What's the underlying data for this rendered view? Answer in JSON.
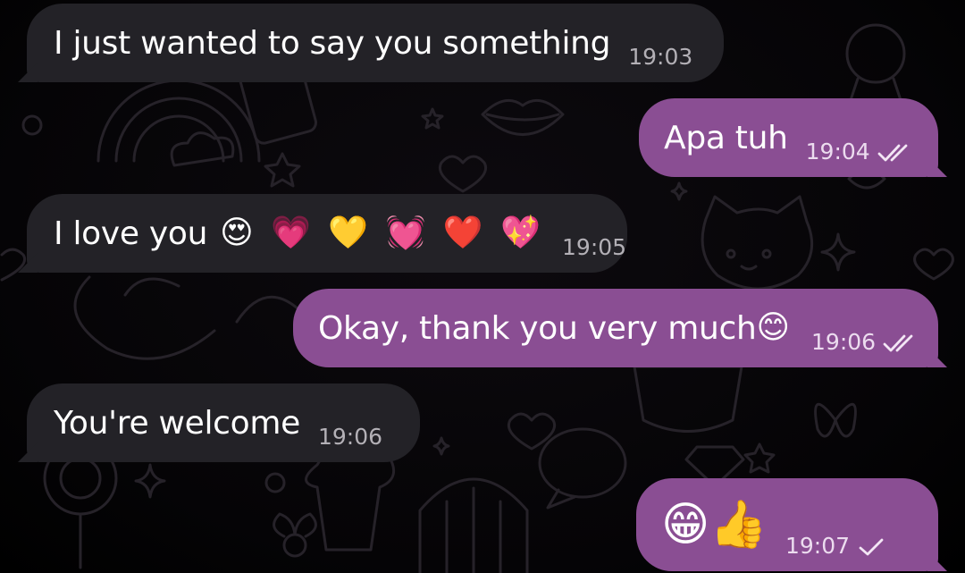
{
  "messages": [
    {
      "direction": "incoming",
      "text": "I just wanted to say you something",
      "time": "19:03"
    },
    {
      "direction": "outgoing",
      "text": "Apa tuh",
      "time": "19:04",
      "status": "read"
    },
    {
      "direction": "incoming",
      "text": "I love you",
      "emoji": "😍 💗 💛 💓 ❤️ 💖",
      "time": "19:05"
    },
    {
      "direction": "outgoing",
      "text": "Okay, thank you very much",
      "emoji": "😊",
      "time": "19:06",
      "status": "read"
    },
    {
      "direction": "incoming",
      "text": "You're welcome",
      "time": "19:06"
    },
    {
      "direction": "outgoing",
      "emoji": "😁👍",
      "time": "19:07",
      "status": "sent"
    }
  ],
  "colors": {
    "incoming_bubble": "#232227",
    "outgoing_bubble": "#8a4e93",
    "background": "#000000"
  },
  "icons": {
    "read_status": "double-check-icon",
    "sent_status": "single-check-icon"
  }
}
